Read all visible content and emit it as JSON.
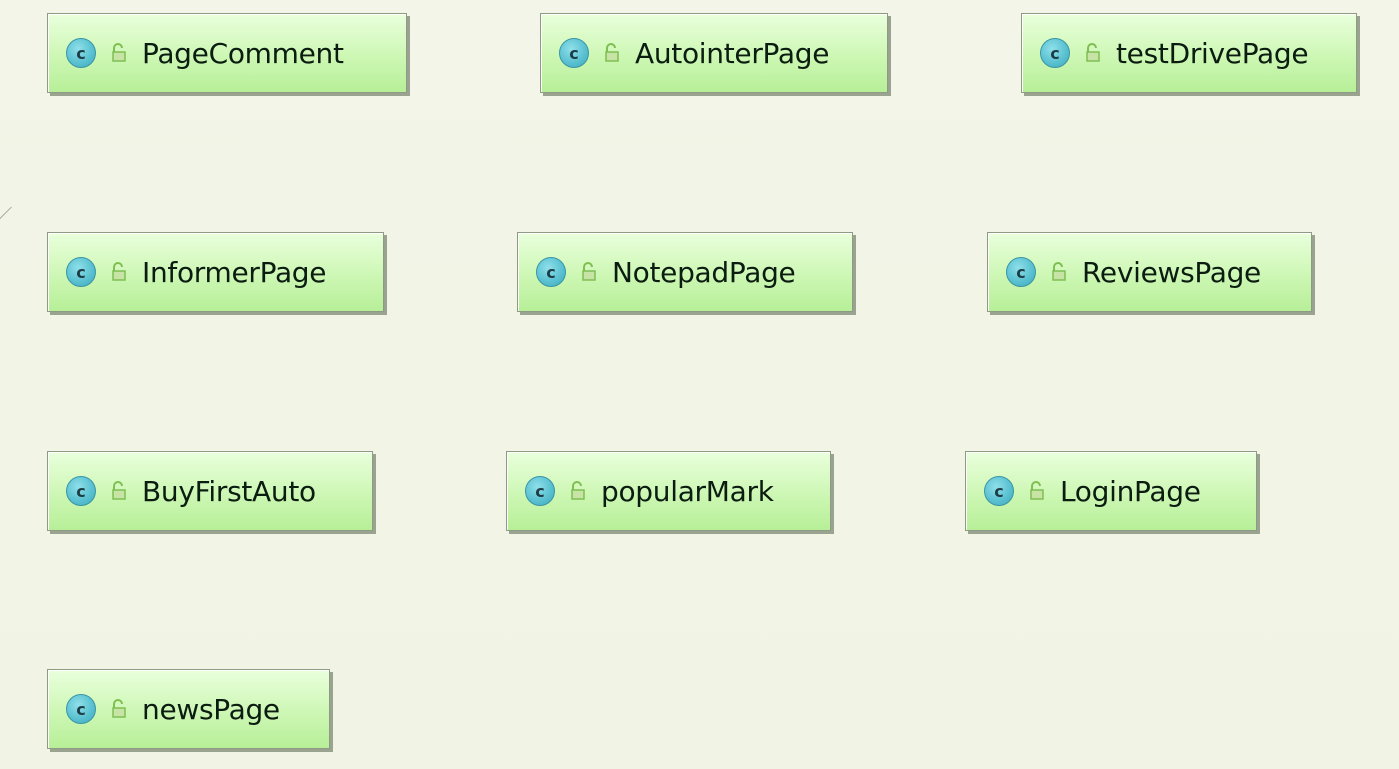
{
  "diagram": {
    "class_icon_letter": "c",
    "icon_names": [
      "class-icon",
      "public-visibility-icon"
    ],
    "colors": {
      "box_fill": "#cdf7b4",
      "class_icon": "#57bfcf",
      "background": "#f2f4e6"
    },
    "classes": [
      {
        "name": "PageComment"
      },
      {
        "name": "AutointerPage"
      },
      {
        "name": "testDrivePage"
      },
      {
        "name": "InformerPage"
      },
      {
        "name": "NotepadPage"
      },
      {
        "name": "ReviewsPage"
      },
      {
        "name": "BuyFirstAuto"
      },
      {
        "name": "popularMark"
      },
      {
        "name": "LoginPage"
      },
      {
        "name": "newsPage"
      }
    ]
  }
}
